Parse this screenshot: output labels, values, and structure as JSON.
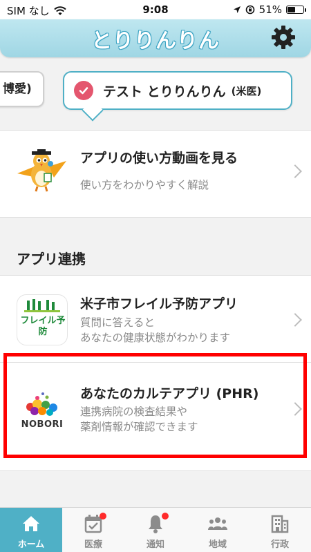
{
  "status_bar": {
    "carrier": "SIM なし",
    "time": "9:08",
    "battery": "51%",
    "battery_level": 0.51
  },
  "header": {
    "logo_text": "とりりんりん"
  },
  "profiles": {
    "left_chip": "博愛)",
    "selected_name": "テスト とりりんりん",
    "selected_hospital": "(米医)"
  },
  "tutorial": {
    "title": "アプリの使い方動画を見る",
    "subtitle": "使い方をわかりやすく解説"
  },
  "app_links": {
    "section_title": "アプリ連携",
    "items": [
      {
        "title": "米子市フレイル予防アプリ",
        "subtitle_line1": "質問に答えると",
        "subtitle_line2": "あなたの健康状態がわかります",
        "icon_label": "フレイル予防"
      },
      {
        "title": "あなたのカルテアプリ (PHR)",
        "subtitle_line1": "連携病院の検査結果や",
        "subtitle_line2": "薬剤情報が確認できます",
        "icon_label": "NOBORI"
      }
    ]
  },
  "tabs": [
    {
      "label": "ホーム",
      "icon": "home-icon",
      "active": true,
      "badge": false
    },
    {
      "label": "医療",
      "icon": "calendar-check-icon",
      "active": false,
      "badge": true
    },
    {
      "label": "通知",
      "icon": "bell-icon",
      "active": false,
      "badge": true
    },
    {
      "label": "地域",
      "icon": "people-icon",
      "active": false,
      "badge": false
    },
    {
      "label": "行政",
      "icon": "building-icon",
      "active": false,
      "badge": false
    }
  ],
  "colors": {
    "accent": "#4fb0c6",
    "check": "#e4566e",
    "highlight": "#ff0000",
    "badge": "#ff2b2b"
  }
}
